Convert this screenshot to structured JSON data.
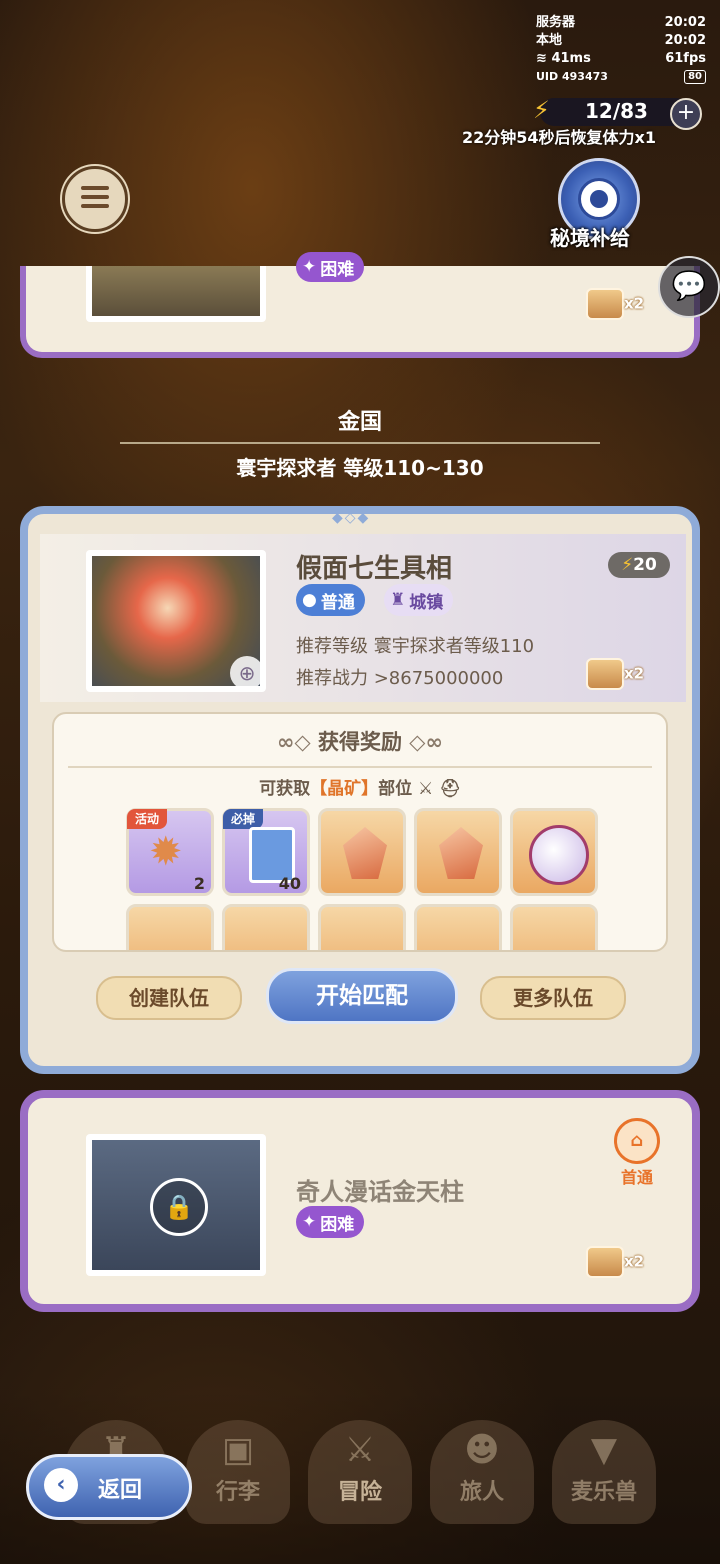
{
  "status": {
    "server_label": "服务器",
    "server_time": "20:02",
    "local_label": "本地",
    "local_time": "20:02",
    "ping": "41ms",
    "fps": "61fps",
    "uid_label": "UID",
    "uid": "493473",
    "battery": "80"
  },
  "stamina": {
    "value": "12/83",
    "recover_text": "22分钟54秒后恢复体力x1"
  },
  "header": {
    "supply_label": "秘境补给"
  },
  "top_card": {
    "difficulty": "困难",
    "chest_mult": "x2"
  },
  "region": {
    "title": "金国",
    "subtitle": "寰宇探求者 等级110~130"
  },
  "dungeon": {
    "name": "假面七生具相",
    "energy_cost": "20",
    "difficulty": "普通",
    "type": "城镇",
    "rec_level": "推荐等级 寰宇探求者等级110",
    "rec_power": "推荐战力 >8675000000",
    "chest_mult": "x2"
  },
  "rewards": {
    "title": "获得奖励",
    "hint_prefix": "可获取",
    "hint_highlight": "【晶矿】",
    "hint_suffix": "部位",
    "items": [
      {
        "tag": "活动",
        "count": "2"
      },
      {
        "tag": "必掉",
        "count": "40"
      },
      {
        "tag": "",
        "count": ""
      },
      {
        "tag": "",
        "count": ""
      },
      {
        "tag": "",
        "count": ""
      }
    ]
  },
  "actions": {
    "create_team": "创建队伍",
    "start_match": "开始匹配",
    "more_teams": "更多队伍"
  },
  "locked_card": {
    "name": "奇人漫话金天柱",
    "difficulty": "困难",
    "first_clear": "首通",
    "chest_mult": "x2"
  },
  "nav": {
    "back": "返回",
    "items": [
      "行李",
      "冒险",
      "旅人",
      "麦乐兽"
    ]
  },
  "colors": {
    "hard": "#9556cf",
    "normal": "#4d7fd6",
    "accent_blue": "#4f75c4",
    "highlight": "#e0752a"
  }
}
